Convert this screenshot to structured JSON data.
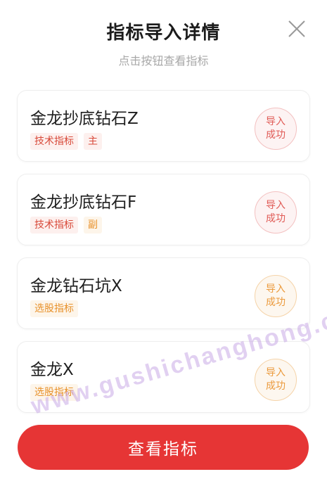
{
  "dialog": {
    "title": "指标导入详情",
    "subtitle": "点击按钮查看指标",
    "close_icon": "close-icon"
  },
  "indicators": [
    {
      "name": "金龙抄底钻石Z",
      "tags": [
        "技术指标",
        "主"
      ],
      "status": "导入成功",
      "status_color": "red"
    },
    {
      "name": "金龙抄底钻石F",
      "tags": [
        "技术指标",
        "副"
      ],
      "status": "导入成功",
      "status_color": "red"
    },
    {
      "name": "金龙钻石坑X",
      "tags": [
        "选股指标"
      ],
      "status": "导入成功",
      "status_color": "orange"
    },
    {
      "name": "金龙X",
      "tags": [
        "选股指标"
      ],
      "status": "导入成功",
      "status_color": "orange"
    }
  ],
  "footer": {
    "button_label": "查看指标"
  },
  "watermark": "www.gushichanghong.com",
  "colors": {
    "accent_red": "#e63535",
    "tag_red": "#d84a3a",
    "tag_orange": "#e8912a"
  }
}
